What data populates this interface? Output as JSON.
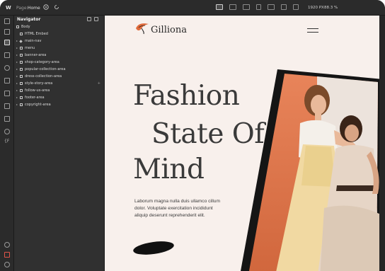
{
  "topbar": {
    "logo": "W",
    "page_label": "Page:",
    "page_value": "Home",
    "size": "1920 PX",
    "zoom": "88.3 %"
  },
  "navigator": {
    "title": "Navigator",
    "items": [
      {
        "label": "Body",
        "kind": "body"
      },
      {
        "label": "HTML Embed",
        "kind": "embed"
      },
      {
        "label": "main-nav",
        "kind": "component"
      },
      {
        "label": "menu",
        "kind": "box"
      },
      {
        "label": "banner-area",
        "kind": "box"
      },
      {
        "label": "shop-category-area",
        "kind": "box"
      },
      {
        "label": "popular-collection-area",
        "kind": "box"
      },
      {
        "label": "dress-collection-area",
        "kind": "box"
      },
      {
        "label": "style-story-area",
        "kind": "box",
        "has_plus": true
      },
      {
        "label": "follow-us-area",
        "kind": "box"
      },
      {
        "label": "footer-area",
        "kind": "box"
      },
      {
        "label": "copyright-area",
        "kind": "box"
      }
    ]
  },
  "site": {
    "brand": "Gilliona",
    "hero_line1": "Fashion",
    "hero_line2": "State Of",
    "hero_line3": "Mind",
    "hero_body": "Laborum magna nulla duis ullamco cillum dolor. Voluptate exercitation incididunt aliquip deserunt reprehenderit elit."
  },
  "colors": {
    "accent": "#e06a3a",
    "canvas_bg": "#f8f0ec",
    "editor_bg": "#262626"
  }
}
